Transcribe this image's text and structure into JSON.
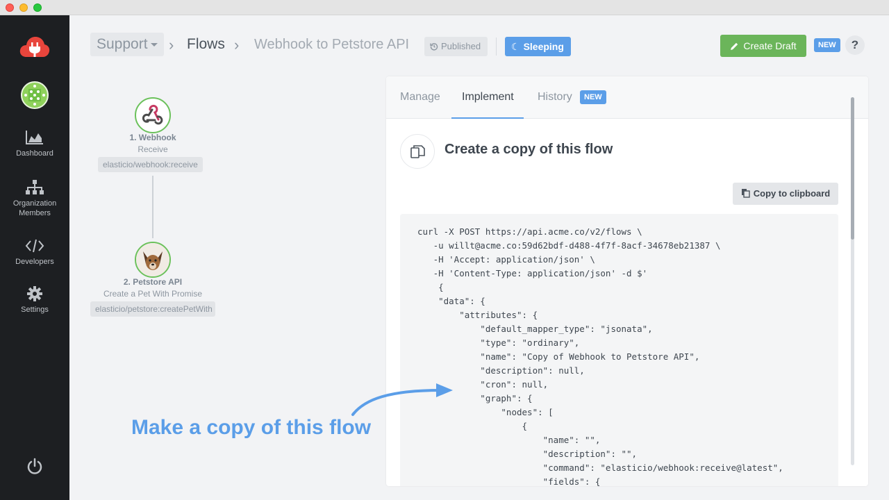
{
  "window": {
    "title": ""
  },
  "sidebar": {
    "items": [
      {
        "label": "Dashboard",
        "icon": "chart-area-icon"
      },
      {
        "label": "Organization Members",
        "icon": "sitemap-icon"
      },
      {
        "label": "Developers",
        "icon": "code-icon"
      },
      {
        "label": "Settings",
        "icon": "gear-icon"
      }
    ],
    "bottom_icon": "power-icon"
  },
  "header": {
    "workspace": "Support",
    "flows": "Flows",
    "flow_name": "Webhook to Petstore API",
    "published_label": "Published",
    "sleeping_label": "Sleeping",
    "create_draft_label": "Create Draft",
    "new_badge": "NEW",
    "help_label": "?"
  },
  "flow": {
    "steps": [
      {
        "title": "1. Webhook",
        "subtitle": "Receive",
        "command": "elasticio/webhook:receive"
      },
      {
        "title": "2. Petstore API",
        "subtitle": "Create a Pet With Promise",
        "command": "elasticio/petstore:createPetWith"
      }
    ]
  },
  "panel": {
    "tabs": [
      {
        "label": "Manage"
      },
      {
        "label": "Implement"
      },
      {
        "label": "History",
        "badge": "NEW"
      }
    ],
    "active_tab": "Implement",
    "section_title": "Create a copy of this flow",
    "copy_button_label": "Copy to clipboard",
    "code": "curl -X POST https://api.acme.co/v2/flows \\\n   -u willt@acme.co:59d62bdf-d488-4f7f-8acf-34678eb21387 \\\n   -H 'Accept: application/json' \\\n   -H 'Content-Type: application/json' -d $'\n    {\n    \"data\": {\n        \"attributes\": {\n            \"default_mapper_type\": \"jsonata\",\n            \"type\": \"ordinary\",\n            \"name\": \"Copy of Webhook to Petstore API\",\n            \"description\": null,\n            \"cron\": null,\n            \"graph\": {\n                \"nodes\": [\n                    {\n                        \"name\": \"\",\n                        \"description\": \"\",\n                        \"command\": \"elasticio/webhook:receive@latest\",\n                        \"fields\": {"
  },
  "annotation": {
    "text": "Make a copy of this flow"
  },
  "colors": {
    "sidebar": "#1d1f22",
    "accent_blue": "#5b9ee8",
    "green": "#6bb55a",
    "logo_red": "#e8453c"
  }
}
